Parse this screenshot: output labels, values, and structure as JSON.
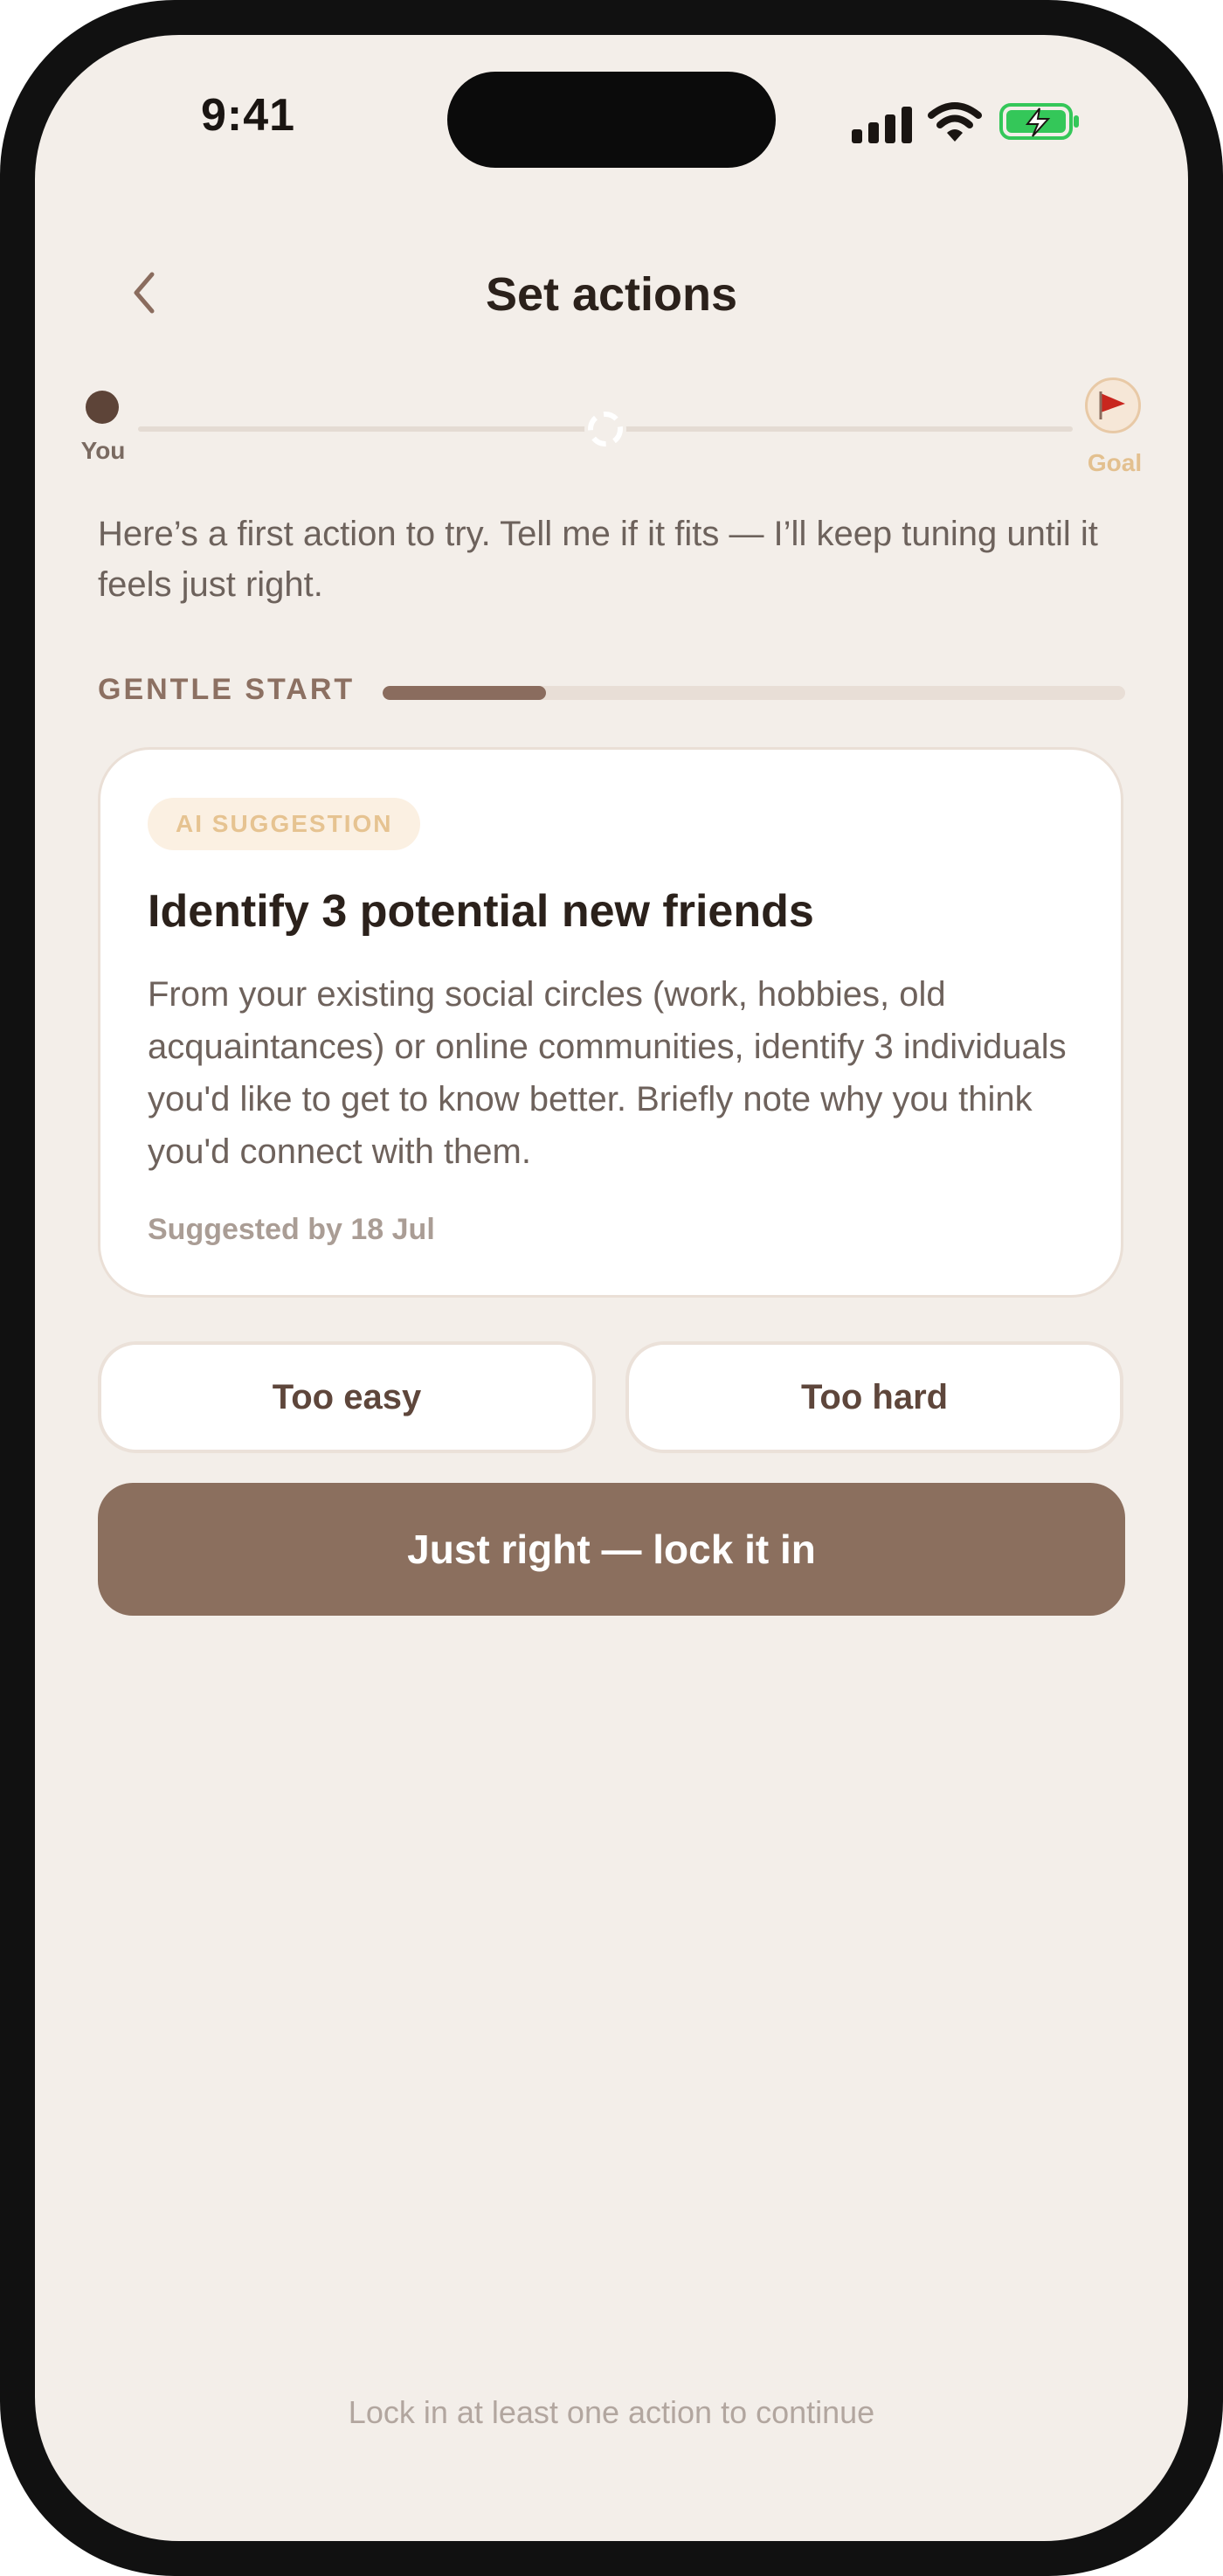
{
  "status_bar": {
    "time": "9:41"
  },
  "header": {
    "title": "Set actions",
    "back_icon": "chevron-left-icon"
  },
  "journey": {
    "start_label": "You",
    "goal_label": "Goal",
    "goal_icon": "flag-icon"
  },
  "intro_text": "Here’s a first action to try. Tell me if it fits — I’ll keep tuning until it feels just right.",
  "difficulty": {
    "label": "GENTLE START",
    "level": 0.22
  },
  "suggestion": {
    "badge": "AI SUGGESTION",
    "title": "Identify 3 potential new friends",
    "description": "From your existing social circles (work, hobbies, old acquaintances) or online communities, identify 3 individuals you'd like to get to know better. Briefly note why you think you'd connect with them.",
    "meta": "Suggested by 18 Jul"
  },
  "actions": {
    "too_easy": "Too easy",
    "too_hard": "Too hard",
    "just_right": "Just right — lock it in"
  },
  "footer_hint": "Lock in at least one action to continue",
  "colors": {
    "background": "#f3eee9",
    "primary": "#8b6f5e",
    "accent": "#e6c391",
    "flag": "#c8261e",
    "battery": "#34c759"
  }
}
